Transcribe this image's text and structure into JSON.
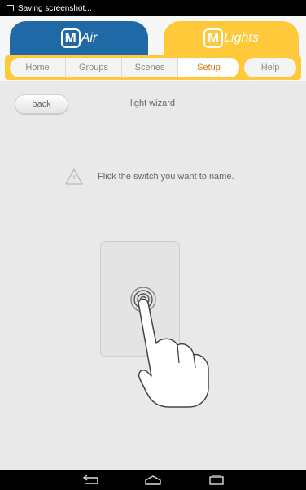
{
  "status_bar": {
    "notification": "Saving screenshot..."
  },
  "brand_tabs": [
    {
      "logo_letter": "M",
      "label": "Air",
      "color": "#1f6aa6"
    },
    {
      "logo_letter": "M",
      "label": "Lights",
      "color": "#ffc93a"
    }
  ],
  "nav": {
    "tabs": [
      {
        "label": "Home"
      },
      {
        "label": "Groups"
      },
      {
        "label": "Scenes"
      },
      {
        "label": "Setup",
        "active": true
      }
    ],
    "help_label": "Help",
    "accent_color": "#d8761c"
  },
  "page": {
    "back_label": "back",
    "title": "light wizard",
    "hint_icon": "warning-triangle-icon",
    "hint": "Flick the switch you want to name."
  },
  "system_nav": {
    "icons": [
      "back-icon",
      "home-icon",
      "recent-apps-icon"
    ]
  }
}
